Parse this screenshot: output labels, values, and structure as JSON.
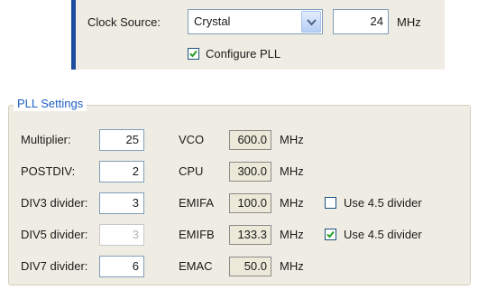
{
  "clock": {
    "source_label": "Clock Source:",
    "source_value": "Crystal",
    "frequency_value": "24",
    "frequency_unit": "MHz",
    "configure_pll_label": "Configure PLL",
    "configure_pll_checked": true
  },
  "pll": {
    "group_title": "PLL Settings",
    "dividers": [
      {
        "label": "Multiplier:",
        "value": "25",
        "enabled": true
      },
      {
        "label": "POSTDIV:",
        "value": "2",
        "enabled": true
      },
      {
        "label": "DIV3 divider:",
        "value": "3",
        "enabled": true
      },
      {
        "label": "DIV5 divider:",
        "value": "3",
        "enabled": false
      },
      {
        "label": "DIV7 divider:",
        "value": "6",
        "enabled": true
      }
    ],
    "clocks": [
      {
        "label": "VCO",
        "value": "600.0",
        "unit": "MHz"
      },
      {
        "label": "CPU",
        "value": "300.0",
        "unit": "MHz"
      },
      {
        "label": "EMIFA",
        "value": "100.0",
        "unit": "MHz"
      },
      {
        "label": "EMIFB",
        "value": "133.3",
        "unit": "MHz"
      },
      {
        "label": "EMAC",
        "value": "50.0",
        "unit": "MHz"
      }
    ],
    "use45_options": [
      {
        "label": "Use 4.5 divider",
        "checked": false
      },
      {
        "label": "Use 4.5 divider",
        "checked": true
      }
    ]
  },
  "colors": {
    "panel_bg": "#efede3",
    "accent_bar": "#1c4d9e",
    "group_title": "#1f5fc4",
    "checkmark": "#21a121"
  },
  "icons": [
    "chevron-down-icon",
    "checkmark-icon"
  ]
}
